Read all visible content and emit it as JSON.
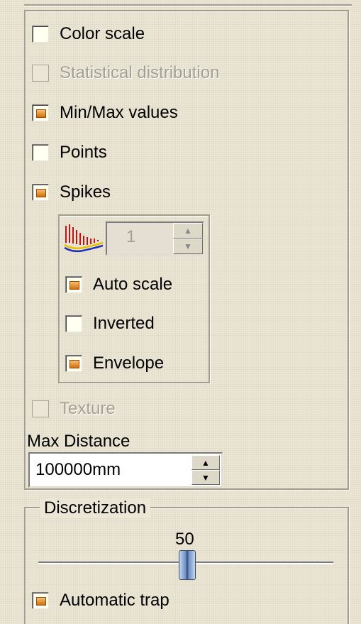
{
  "options": {
    "color_scale": {
      "label": "Color scale",
      "checked": false,
      "enabled": true
    },
    "statistical_distribution": {
      "label": "Statistical distribution",
      "checked": false,
      "enabled": false
    },
    "min_max_values": {
      "label": "Min/Max values",
      "checked": true,
      "enabled": true
    },
    "points": {
      "label": "Points",
      "checked": false,
      "enabled": true
    },
    "spikes": {
      "label": "Spikes",
      "checked": true,
      "enabled": true
    }
  },
  "spikes_panel": {
    "icon": "spikes-density-icon",
    "density_value": "1",
    "auto_scale": {
      "label": "Auto scale",
      "checked": true
    },
    "inverted": {
      "label": "Inverted",
      "checked": false
    },
    "envelope": {
      "label": "Envelope",
      "checked": true
    }
  },
  "texture": {
    "label": "Texture",
    "checked": false,
    "enabled": false
  },
  "max_distance": {
    "label": "Max Distance",
    "value": "100000mm"
  },
  "discretization": {
    "title": "Discretization",
    "value_label": "50",
    "value": 50,
    "automatic_trap": {
      "label": "Automatic trap",
      "checked": true
    }
  },
  "colors": {
    "background": "#ece6d6",
    "check_fill": "#e07a10",
    "disabled_text": "#a49f93"
  }
}
